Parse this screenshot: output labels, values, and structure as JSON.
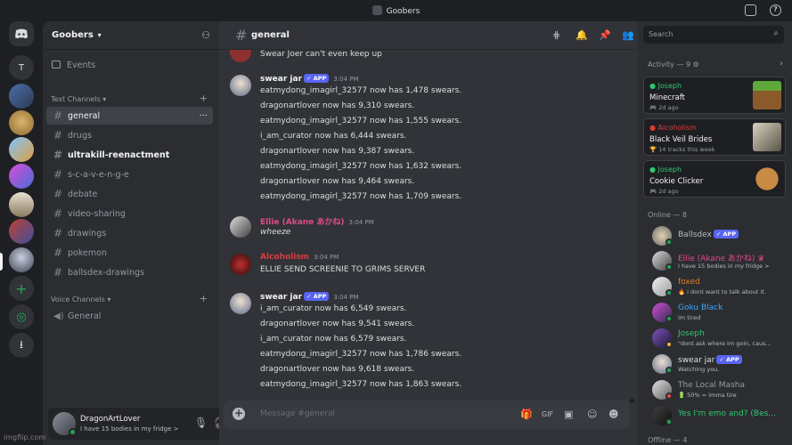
{
  "window": {
    "title": "Goobers"
  },
  "colors": {
    "accent": "#5865f2",
    "online": "#23a559",
    "dnd": "#f23f43",
    "idle": "#f0b232",
    "joseph": "#2dc770",
    "alcoholism": "#e03b3b",
    "ellie": "#e04a8a",
    "foxed": "#e67e22",
    "goku": "#3ea6ff",
    "masha": "#b5bac1"
  },
  "guilds": [
    {
      "name": "discord-home-icon",
      "label": ""
    },
    {
      "name": "guild-t",
      "label": "T"
    },
    {
      "name": "add-server-icon",
      "label": "+"
    },
    {
      "name": "discover-icon",
      "label": "◎"
    },
    {
      "name": "download-icon",
      "label": "⭳"
    }
  ],
  "server": {
    "name": "Goobers",
    "events_label": "Events"
  },
  "text_category": "Text Channels",
  "voice_category": "Voice Channels",
  "channels": [
    "general",
    "drugs",
    "ultrakill-reenactment",
    "s-c-a-v-e-n-g-e",
    "debate",
    "video-sharing",
    "drawings",
    "pokemon",
    "ballsdex-drawings"
  ],
  "voice_channels": [
    "General"
  ],
  "user": {
    "name": "DragonArtLover",
    "status": "I have 15 bodies in my fridge >"
  },
  "chat": {
    "channel": "general",
    "placeholder": "Message #general",
    "top_line": "Swear Joer can't even keep up",
    "groups": [
      {
        "author": "swear jar",
        "app": "APP",
        "time": "3:04 PM",
        "lines": [
          "eatmydong_imagirl_32577 now has 1,478 swears.",
          "dragonartlover now has 9,310 swears.",
          "eatmydong_imagirl_32577 now has 1,555 swears.",
          "i_am_curator now has 6,444 swears.",
          "dragonartlover now has 9,387 swears.",
          "eatmydong_imagirl_32577 now has 1,632 swears.",
          "dragonartlover now has 9,464 swears.",
          "eatmydong_imagirl_32577 now has 1,709 swears."
        ]
      },
      {
        "author": "Ellie (Akane あかね)",
        "time": "3:04 PM",
        "lines": [
          "wheeze"
        ]
      },
      {
        "author": "Alcoholism",
        "time": "3:04 PM",
        "lines": [
          "ELLIE SEND SCREENIE TO GRIMS SERVER"
        ]
      },
      {
        "author": "swear jar",
        "app": "APP",
        "time": "3:04 PM",
        "lines": [
          "i_am_curator now has 6,549 swears.",
          "dragonartlover now has 9,541 swears.",
          "i_am_curator now has 6,579 swears.",
          "eatmydong_imagirl_32577 now has 1,786 swears.",
          "dragonartlover now has 9,618 swears.",
          "eatmydong_imagirl_32577 now has 1,863 swears."
        ]
      }
    ]
  },
  "search": {
    "placeholder": "Search"
  },
  "activity": {
    "header": "Activity — 9",
    "cards": [
      {
        "who": "Joseph",
        "what": "Minecraft",
        "when": "2d ago"
      },
      {
        "who": "Alcoholism",
        "what": "Black Veil Brides",
        "when": "14 tracks this week"
      },
      {
        "who": "Joseph",
        "what": "Cookie Clicker",
        "when": "2d ago"
      }
    ]
  },
  "members": {
    "online_header": "Online — 8",
    "offline_header": "Offline — 4",
    "list": [
      {
        "name": "Ballsdex",
        "app": "APP",
        "status": ""
      },
      {
        "name": "Ellie (Akane あかね) ♛",
        "status": "I have 15 bodies in my fridge >"
      },
      {
        "name": "foxed",
        "status": "i dont want to talk about it."
      },
      {
        "name": "Goku Black",
        "status": "im tired"
      },
      {
        "name": "Joseph",
        "status": "\"dont ask where im goin, caus..."
      },
      {
        "name": "swear jar",
        "app": "APP",
        "status": "Watching you."
      },
      {
        "name": "The Local Masha",
        "status": "50% = imma tire"
      },
      {
        "name": "Yes I'm emo and? (Bes...",
        "status": ""
      }
    ]
  },
  "watermark": "imgflip.com"
}
